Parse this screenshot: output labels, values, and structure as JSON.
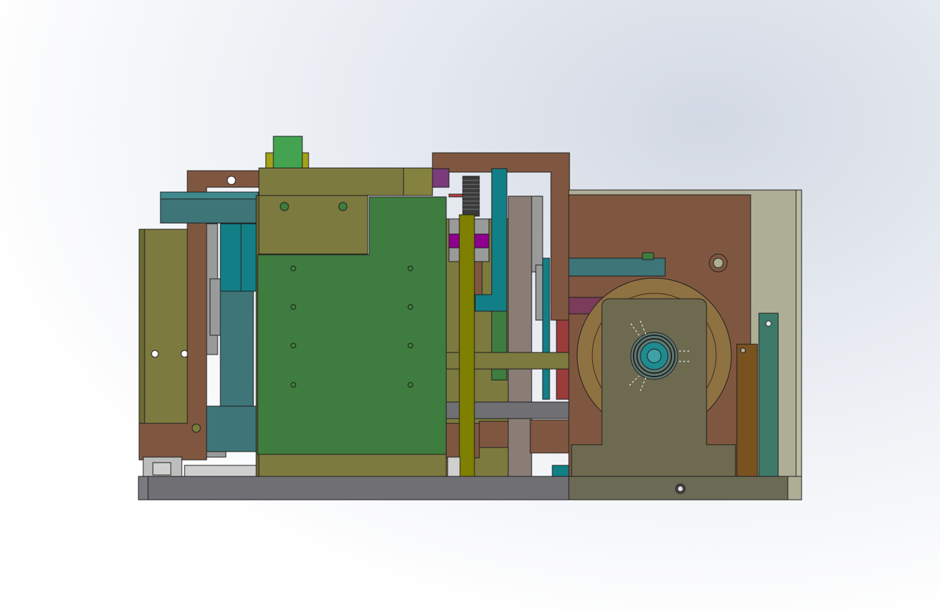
{
  "scene": {
    "background_colors": [
      "#ffffff",
      "#d3d9e4"
    ],
    "part_colors": {
      "olive": "#7d7a3f",
      "olive_dark": "#6b6a35",
      "brown": "#7f5740",
      "green": "#3f7c3f",
      "green_light": "#44a350",
      "teal": "#127f86",
      "teal_dark": "#3e7579",
      "gray": "#6f6f74",
      "gray_light": "#9a9a9a",
      "yellow_olive": "#7f7f00",
      "magenta": "#8e008e",
      "purple": "#7a3c7a",
      "beige": "#aeae96",
      "orange_brown": "#7a5220"
    }
  }
}
